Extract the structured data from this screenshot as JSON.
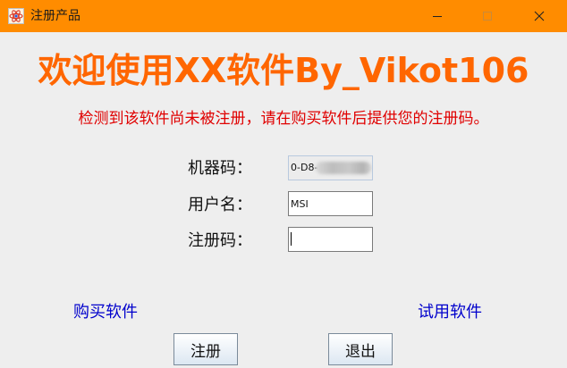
{
  "window": {
    "title": "注册产品",
    "minimize_glyph": "—",
    "maximize_glyph": "☐",
    "close_glyph": "✕",
    "icon": "app-atom-icon",
    "titlebar_color": "#ff8c00"
  },
  "main": {
    "heading": "欢迎使用XX软件By_Vikot106",
    "heading_color": "#ff6600",
    "notice": "检测到该软件尚未被注册，请在购买软件后提供您的注册码。",
    "notice_color": "#e00000"
  },
  "form": {
    "machine_code_label": "机器码：",
    "machine_code_value": "0-D8-",
    "username_label": "用户名：",
    "username_value": "MSI",
    "regcode_label": "注册码：",
    "regcode_value": ""
  },
  "links": {
    "buy": "购买软件",
    "trial": "试用软件",
    "color": "#0000cc"
  },
  "buttons": {
    "register": "注册",
    "exit": "退出"
  }
}
